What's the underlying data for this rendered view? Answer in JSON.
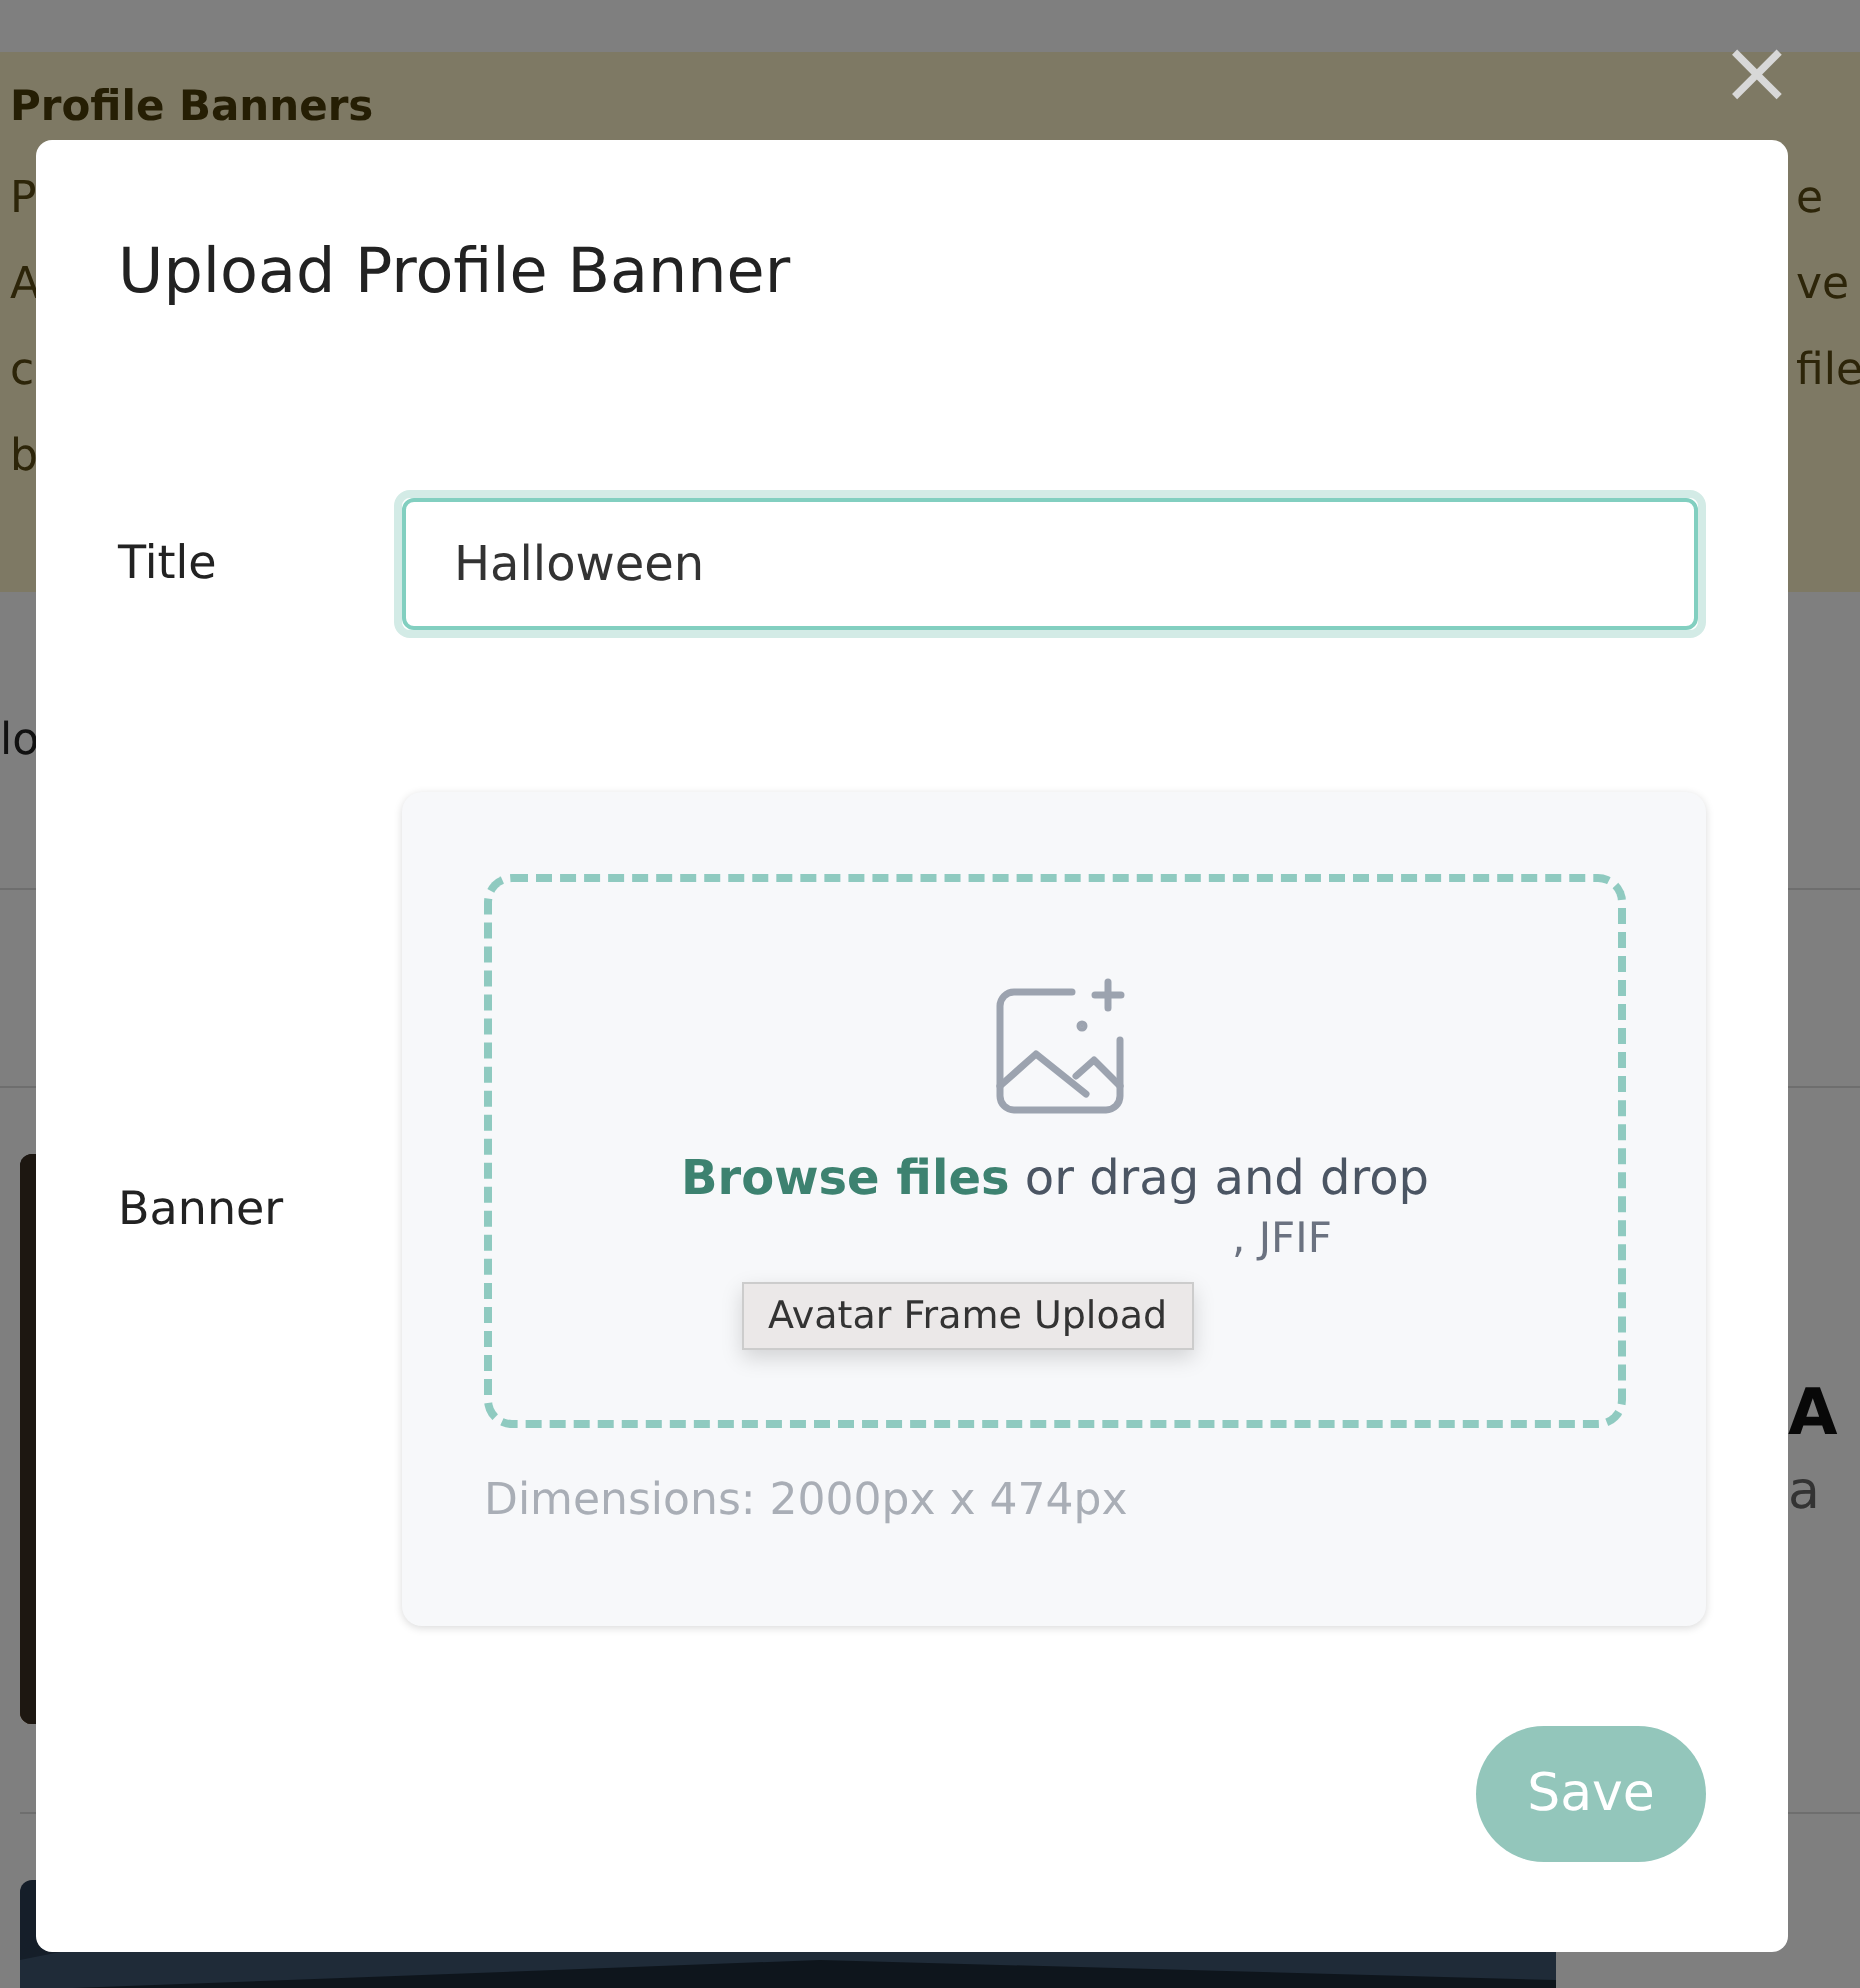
{
  "background": {
    "banner": {
      "heading": "Profile Banners",
      "left_fragments": [
        "P",
        "A",
        "c",
        "b"
      ],
      "right_fragments": [
        "e",
        "ve",
        "file"
      ]
    },
    "row_fragment": "lo",
    "card_title_fragment": "A",
    "card_text_fragment": "a"
  },
  "close_icon": "×",
  "modal": {
    "title": "Upload Profile Banner",
    "fields": [
      {
        "kind": "text",
        "label": "Title",
        "value": "Halloween"
      },
      {
        "kind": "upload",
        "label": "Banner",
        "browse_link": "Browse files",
        "drop_text": "or drag and drop",
        "formats_visible": ", JFIF",
        "dimensions": "Dimensions: 2000px x 474px"
      }
    ],
    "tooltip": "Avatar Frame Upload",
    "save_button": {
      "label": "Save",
      "disabled": true
    }
  }
}
